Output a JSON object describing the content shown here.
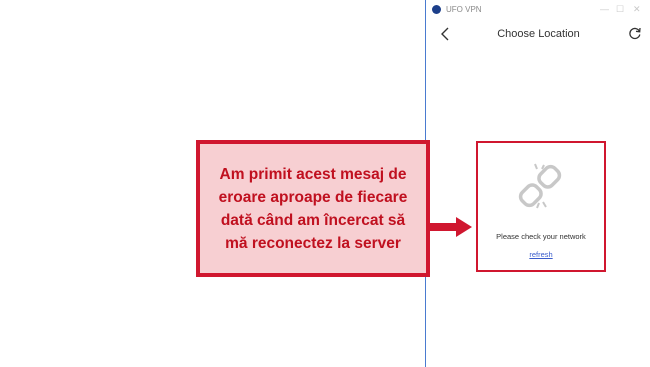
{
  "app": {
    "title": "UFO VPN",
    "window_controls": {
      "minimize": "—",
      "maximize": "☐",
      "close": "✕"
    }
  },
  "header": {
    "title": "Choose Location",
    "back_icon": "chevron-left-icon",
    "refresh_icon": "refresh-icon"
  },
  "error_panel": {
    "icon": "broken-link-icon",
    "message": "Please check your network",
    "refresh_label": "refresh"
  },
  "callout": {
    "text": "Am primit acest mesaj de eroare aproape de fiecare dată când am încercat să mă reconectez la server"
  },
  "colors": {
    "accent_red": "#d0172f",
    "callout_fill": "#f7cfd2",
    "link_blue": "#3a5ccc",
    "window_border": "#4a7bd0"
  }
}
